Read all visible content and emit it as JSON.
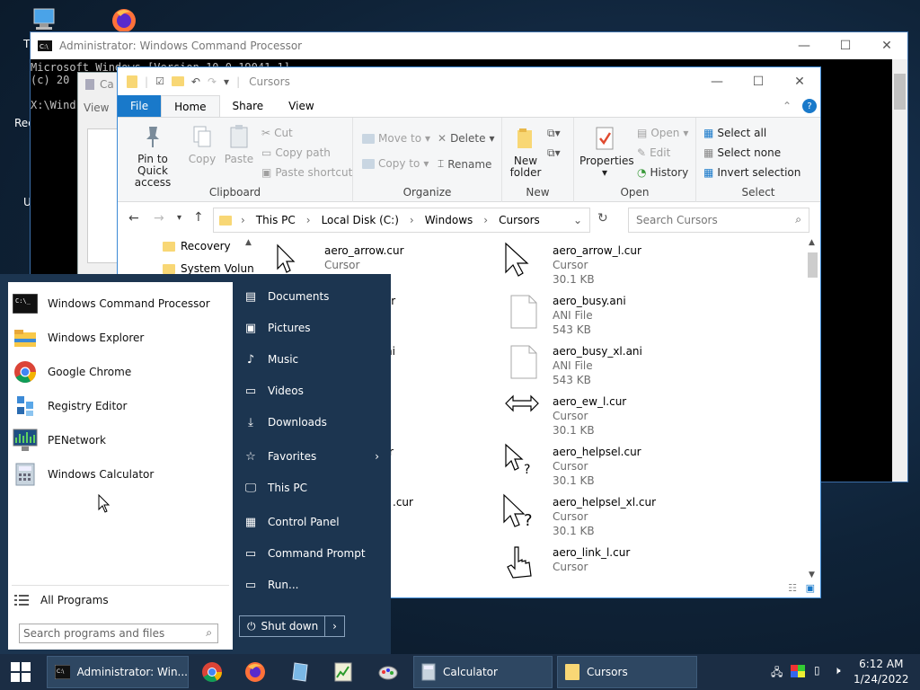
{
  "desktop": {
    "labels": [
      "Th",
      "Rec",
      "U"
    ]
  },
  "cmd": {
    "title": "Administrator: Windows Command Processor",
    "lines": [
      "Microsoft Windows [Version 10.0.19041.1]",
      "(c) 20",
      "",
      "X:\\Wind"
    ]
  },
  "calc": {
    "title": "Ca",
    "menu": "View"
  },
  "explorer": {
    "title": "Cursors",
    "tabs": [
      "File",
      "Home",
      "Share",
      "View"
    ],
    "clipboard": {
      "pin": "Pin to Quick access",
      "copy": "Copy",
      "paste": "Paste",
      "cut": "Cut",
      "copy_path": "Copy path",
      "paste_shortcut": "Paste shortcut",
      "label": "Clipboard"
    },
    "organize": {
      "move_to": "Move to",
      "copy_to": "Copy to",
      "delete": "Delete",
      "rename": "Rename",
      "label": "Organize"
    },
    "new": {
      "new_folder": "New folder",
      "label": "New"
    },
    "open": {
      "properties": "Properties",
      "open": "Open",
      "edit": "Edit",
      "history": "History",
      "label": "Open"
    },
    "select": {
      "select_all": "Select all",
      "select_none": "Select none",
      "invert": "Invert selection",
      "label": "Select"
    },
    "breadcrumb": [
      "This PC",
      "Local Disk (C:)",
      "Windows",
      "Cursors"
    ],
    "search_placeholder": "Search Cursors",
    "nav": [
      "Recovery",
      "System Volun"
    ],
    "files_left": [
      {
        "name": "aero_arrow.cur",
        "type": "Cursor"
      },
      {
        "name": "cur"
      },
      {
        "name": "ni"
      },
      {
        "name": "r"
      },
      {
        "name": ".cur"
      }
    ],
    "files_right": [
      {
        "name": "aero_arrow_l.cur",
        "type": "Cursor",
        "size": "30.1 KB"
      },
      {
        "name": "aero_busy.ani",
        "type": "ANI File",
        "size": "543 KB"
      },
      {
        "name": "aero_busy_xl.ani",
        "type": "ANI File",
        "size": "543 KB"
      },
      {
        "name": "aero_ew_l.cur",
        "type": "Cursor",
        "size": "30.1 KB"
      },
      {
        "name": "aero_helpsel.cur",
        "type": "Cursor",
        "size": "30.1 KB"
      },
      {
        "name": "aero_helpsel_xl.cur",
        "type": "Cursor",
        "size": "30.1 KB"
      },
      {
        "name": "aero_link_l.cur",
        "type": "Cursor",
        "size": ""
      }
    ]
  },
  "start_menu": {
    "programs": [
      "Windows Command Processor",
      "Windows Explorer",
      "Google Chrome",
      "Registry Editor",
      "PENetwork",
      "Windows Calculator"
    ],
    "all_programs": "All Programs",
    "search_placeholder": "Search programs and files",
    "right": [
      "Documents",
      "Pictures",
      "Music",
      "Videos",
      "Downloads",
      "Favorites",
      "This PC",
      "Control Panel",
      "Command Prompt",
      "Run..."
    ],
    "shutdown": "Shut down"
  },
  "taskbar": {
    "cmd": "Administrator: Win...",
    "calculator": "Calculator",
    "cursors": "Cursors",
    "time": "6:12 AM",
    "date": "1/24/2022"
  }
}
